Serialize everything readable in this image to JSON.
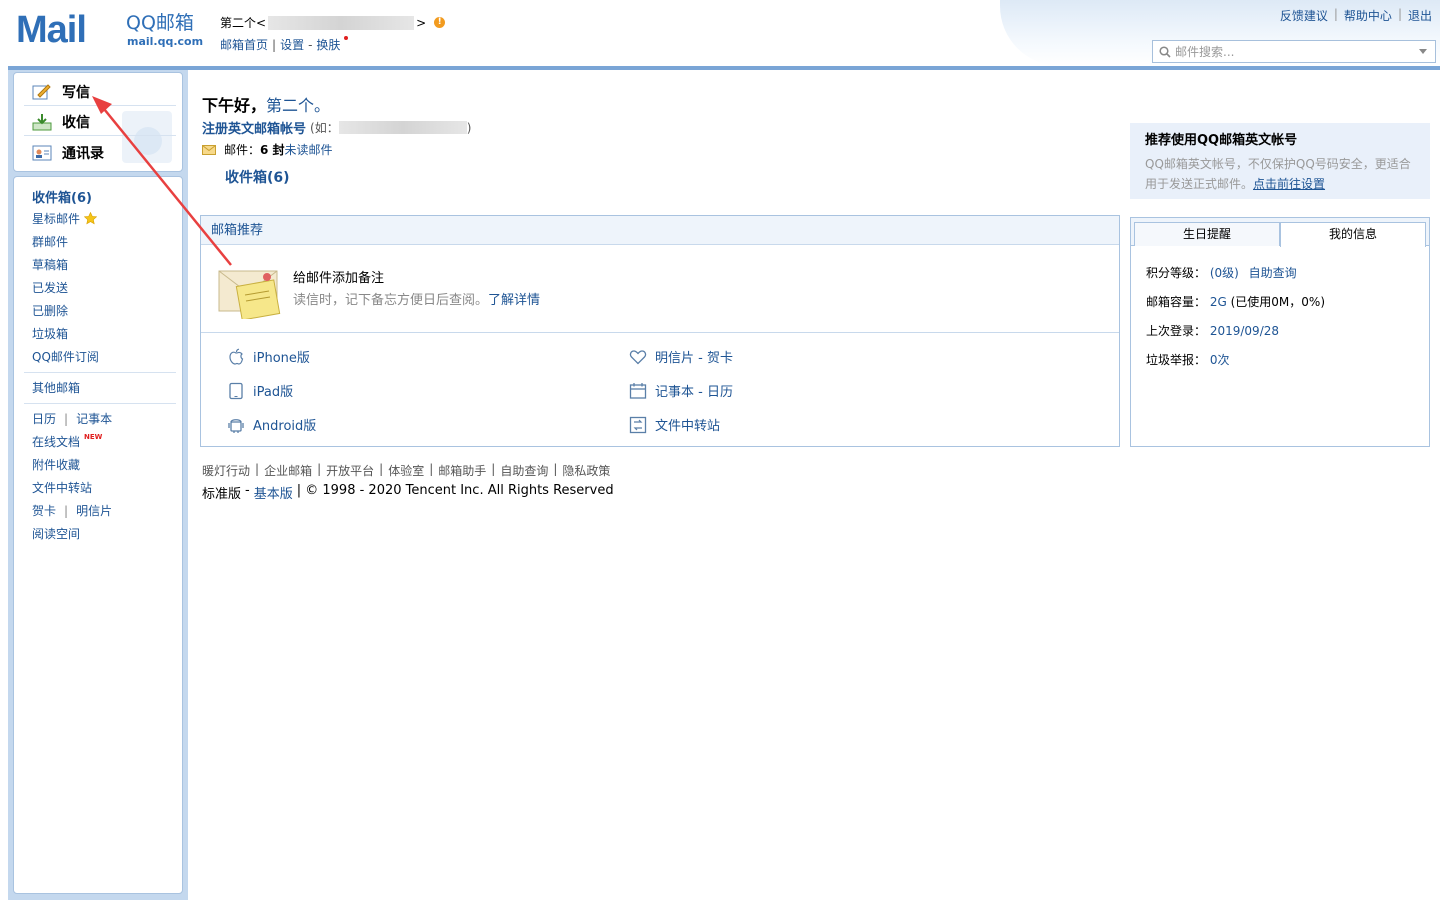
{
  "header": {
    "logo_mail": "Mail",
    "logo_brand": "QQ邮箱",
    "logo_domain": "mail.qq.com",
    "account_name": "第二个<",
    "account_close": ">",
    "warn_glyph": "!",
    "links": {
      "home": "邮箱首页",
      "sep": "|",
      "settings": "设置",
      "dash": "-",
      "skin": "换肤"
    },
    "top_links": [
      "反馈建议",
      "|",
      "帮助中心",
      "|",
      "退出"
    ],
    "search_placeholder": "邮件搜索..."
  },
  "nav": {
    "compose": "写信",
    "receive": "收信",
    "contacts": "通讯录"
  },
  "folders": {
    "inbox": "收件箱(6)",
    "starred": "星标邮件",
    "group": "群邮件",
    "drafts": "草稿箱",
    "sent": "已发送",
    "deleted": "已删除",
    "spam": "垃圾箱",
    "subscriptions": "QQ邮件订阅",
    "other": "其他邮箱",
    "calendar": "日历",
    "divider": "|",
    "notes": "记事本",
    "docs": "在线文档",
    "new_tag": "NEW",
    "attachments": "附件收藏",
    "transfer": "文件中转站",
    "cards": "贺卡",
    "postcards": "明信片",
    "reading": "阅读空间"
  },
  "main": {
    "greeting": "下午好，",
    "greeting_name": "第二个。",
    "register_link": "注册英文邮箱帐号",
    "register_eg": "(如：",
    "register_close": ")",
    "mail_label": "邮件：",
    "mail_count": "6 封",
    "unread": "未读邮件",
    "inbox_link": "收件箱(6)"
  },
  "recommend": {
    "title": "邮箱推荐",
    "tip_title": "给邮件添加备注",
    "tip_desc": "读信时，记下备忘方便日后查阅。",
    "tip_link": "了解详情",
    "apps": {
      "iphone": "iPhone版",
      "ipad": "iPad版",
      "android": "Android版",
      "postcard": "明信片 - 贺卡",
      "notebook": "记事本 - 日历",
      "transfer": "文件中转站"
    }
  },
  "promo": {
    "title": "推荐使用QQ邮箱英文帐号",
    "desc": "QQ邮箱英文帐号，不仅保护QQ号码安全，更适合用于发送正式邮件。",
    "link": "点击前往设置"
  },
  "info": {
    "tab_birthday": "生日提醒",
    "tab_myinfo": "我的信息",
    "level_label": "积分等级：",
    "level_value": "(0级)",
    "level_link": "自助查询",
    "capacity_label": "邮箱容量：",
    "capacity_value": "2G",
    "capacity_used": "(已使用0M，0%)",
    "login_label": "上次登录：",
    "login_value": "2019/09/28",
    "spam_label": "垃圾举报：",
    "spam_value": "0次"
  },
  "footer": {
    "links": [
      "暖灯行动",
      "|",
      "企业邮箱",
      "|",
      "开放平台",
      "|",
      "体验室",
      "|",
      "邮箱助手",
      "|",
      "自助查询",
      "|",
      "隐私政策"
    ],
    "edition": "标准版",
    "dash": "-",
    "basic": "基本版",
    "copyright": "| © 1998 - 2020 Tencent Inc. All Rights Reserved"
  },
  "colors": {
    "accent": "#1e5494",
    "frame": "#7aa5d6",
    "arrow": "#e84040"
  }
}
